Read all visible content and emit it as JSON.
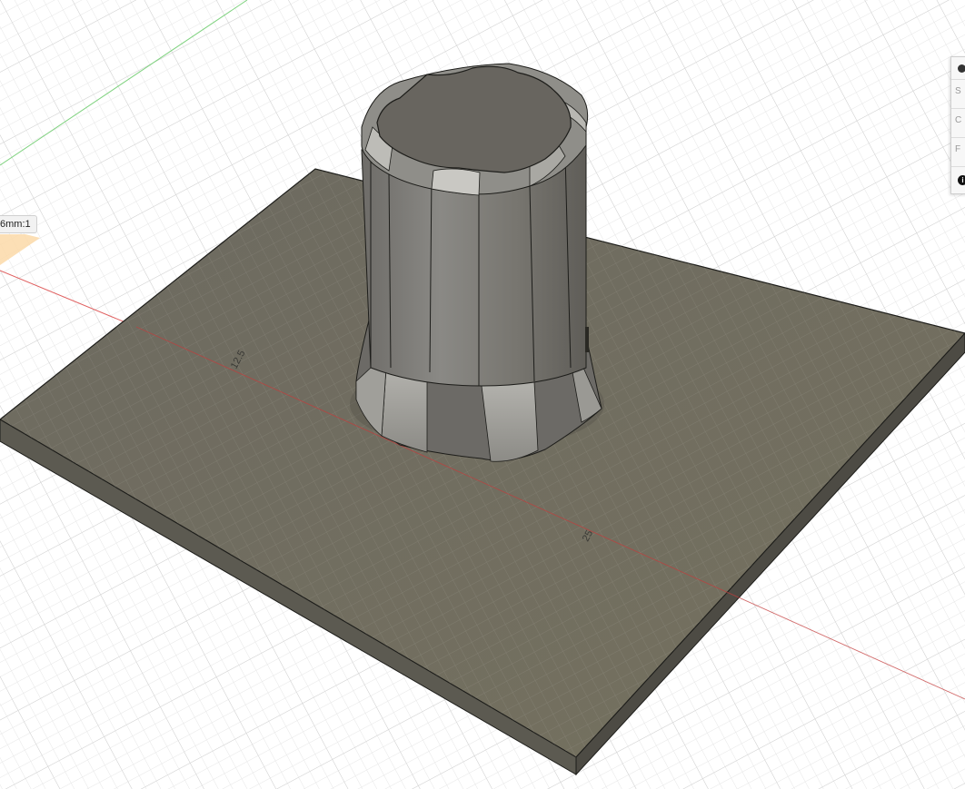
{
  "viewport": {
    "scale_label": "6mm:1",
    "dimension_labels": [
      "12.5",
      "25"
    ]
  },
  "side_panel": {
    "rows": [
      "S",
      "C",
      "F"
    ]
  }
}
